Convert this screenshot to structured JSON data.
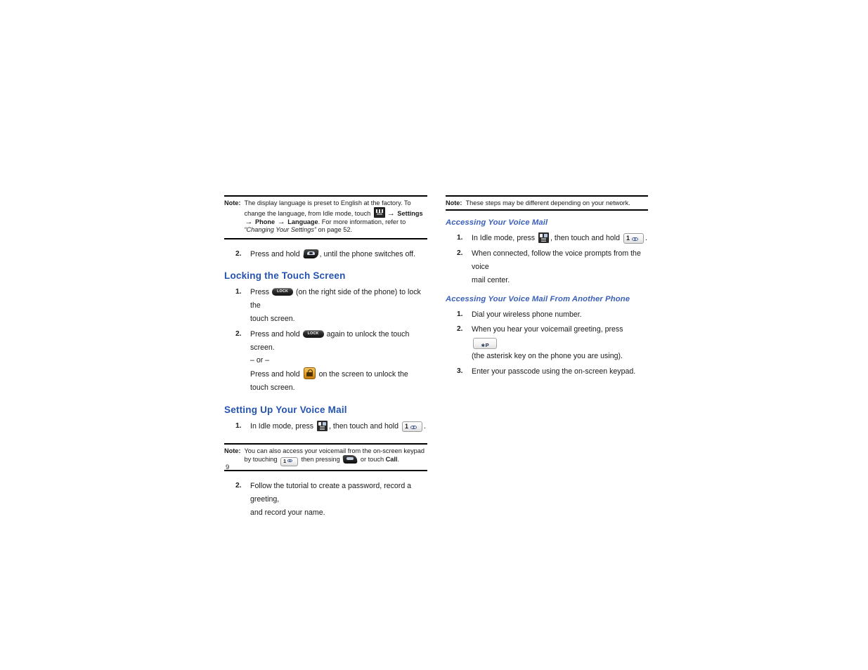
{
  "document": {
    "page_number": "9"
  },
  "left_column": {
    "note_language": {
      "label": "Note:",
      "text_part1": "The display language is preset to English at the factory. To change the language, from Idle mode, touch ",
      "icon": "menu-grid-icon",
      "arrow1": "→",
      "bold1": "Settings",
      "arrow2": "→",
      "bold2": "Phone",
      "arrow3": "→",
      "bold3": "Language",
      "text_part2": ". For more information, refer to ",
      "italic_ref": "“Changing Your Settings”",
      "text_part3": " on page 52."
    },
    "step_power_off": {
      "num": "2.",
      "text_before": "Press and hold",
      "icon": "end-call-key-icon",
      "text_after": ", until the phone switches off."
    },
    "heading_locking": "Locking the Touch Screen",
    "locking_steps": [
      {
        "num": "1.",
        "text_before": "Press",
        "icon": "lock-side-key-icon",
        "icon_label": "LOCK",
        "text_after": "(on the right side of the phone) to lock the",
        "line2": "touch screen."
      },
      {
        "num": "2.",
        "text_before": "Press and hold",
        "icon": "lock-side-key-icon",
        "icon_label": "LOCK",
        "text_after": "again to unlock the touch screen.",
        "or_line": "– or –",
        "alt_text_before": "Press and hold",
        "alt_icon": "orange-padlock-icon",
        "alt_text_after": "on the screen to unlock the",
        "alt_line2": "touch screen."
      }
    ],
    "heading_voicemail_setup": "Setting Up Your Voice Mail",
    "setup_step1": {
      "num": "1.",
      "text_before": "In Idle mode, press",
      "icon": "dial-pad-icon",
      "text_middle": ", then touch and hold",
      "key_label": "1",
      "key_icon": "voicemail-symbol-icon",
      "text_after": "."
    },
    "note_voicemail": {
      "label": "Note:",
      "text_part1": "You can also access your voicemail from the on-screen keypad by touching ",
      "key_label": "1",
      "key_icon": "voicemail-symbol-icon",
      "text_part2": " then pressing ",
      "send_icon": "send-call-key-icon",
      "text_part3": " or touch ",
      "bold_call": "Call",
      "text_part4": "."
    },
    "setup_step2": {
      "num": "2.",
      "line1": "Follow the tutorial to create a password, record a greeting,",
      "line2": "and record your name."
    }
  },
  "right_column": {
    "note_network": {
      "label": "Note:",
      "text": "These steps may be different depending on your network."
    },
    "heading_accessing": "Accessing Your Voice Mail",
    "accessing_steps": [
      {
        "num": "1.",
        "text_before": "In Idle mode, press",
        "icon": "dial-pad-icon",
        "text_middle": ", then touch and hold",
        "key_label": "1",
        "key_icon": "voicemail-symbol-icon",
        "text_after": "."
      },
      {
        "num": "2.",
        "line1": "When connected, follow the voice prompts from the voice",
        "line2": "mail center."
      }
    ],
    "heading_another_phone": "Accessing Your Voice Mail From Another Phone",
    "another_phone_steps": [
      {
        "num": "1.",
        "line1": "Dial your wireless phone number."
      },
      {
        "num": "2.",
        "text_before": "When you hear your voicemail greeting, press",
        "key_label": "∗P",
        "line2": "(the asterisk key on the phone you are using)."
      },
      {
        "num": "3.",
        "line1": "Enter your passcode using the on-screen keypad."
      }
    ]
  },
  "colors": {
    "section_heading": "#2553b0",
    "sub_heading": "#3b60bb",
    "padlock_button": "#e8a62b",
    "body_text": "#1a1a1a"
  }
}
